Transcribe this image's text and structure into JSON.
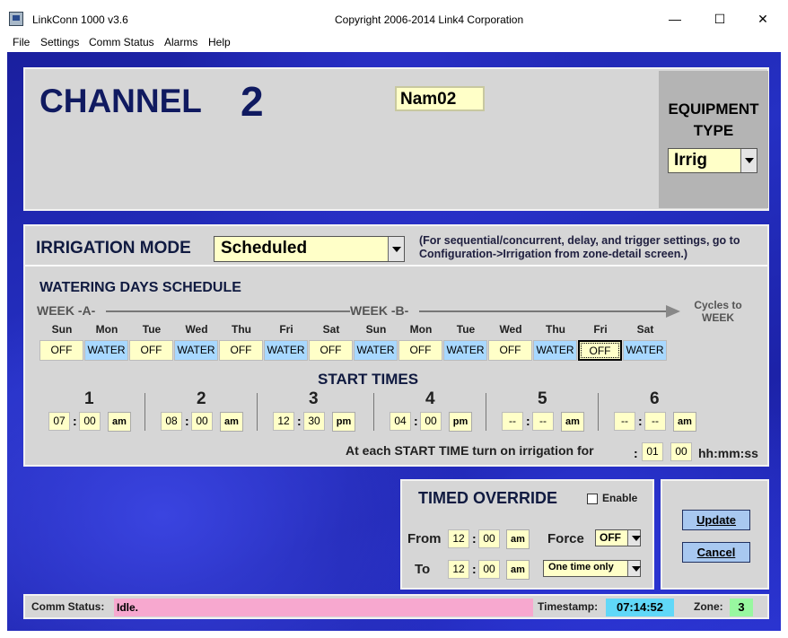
{
  "window": {
    "title": "LinkConn 1000 v3.6",
    "copyright": "Copyright 2006-2014 Link4 Corporation",
    "minimize": "—",
    "maximize": "☐",
    "close": "✕"
  },
  "menu": [
    "File",
    "Settings",
    "Comm Status",
    "Alarms",
    "Help"
  ],
  "channel": {
    "label": "CHANNEL",
    "number": "2",
    "name": "Nam02"
  },
  "equipment": {
    "label_line1": "EQUIPMENT",
    "label_line2": "TYPE",
    "value": "Irrig"
  },
  "irrigation": {
    "mode_label": "IRRIGATION MODE",
    "mode_value": "Scheduled",
    "note": "(For sequential/concurrent, delay, and trigger settings, go to Configuration->Irrigation from zone-detail screen.)"
  },
  "schedule": {
    "title": "WATERING DAYS SCHEDULE",
    "week_a": "WEEK -A-",
    "week_b": "WEEK -B-",
    "cycles": "Cycles to WEEK",
    "days": [
      {
        "name": "Sun",
        "state": "OFF"
      },
      {
        "name": "Mon",
        "state": "WATER"
      },
      {
        "name": "Tue",
        "state": "OFF"
      },
      {
        "name": "Wed",
        "state": "WATER"
      },
      {
        "name": "Thu",
        "state": "OFF"
      },
      {
        "name": "Fri",
        "state": "WATER"
      },
      {
        "name": "Sat",
        "state": "OFF"
      },
      {
        "name": "Sun",
        "state": "WATER"
      },
      {
        "name": "Mon",
        "state": "OFF"
      },
      {
        "name": "Tue",
        "state": "WATER"
      },
      {
        "name": "Wed",
        "state": "OFF"
      },
      {
        "name": "Thu",
        "state": "WATER"
      },
      {
        "name": "Fri",
        "state": "OFF"
      },
      {
        "name": "Sat",
        "state": "WATER"
      }
    ]
  },
  "start_times": {
    "title": "START TIMES",
    "entries": [
      {
        "num": "1",
        "hh": "07",
        "mm": "00",
        "ampm": "am"
      },
      {
        "num": "2",
        "hh": "08",
        "mm": "00",
        "ampm": "am"
      },
      {
        "num": "3",
        "hh": "12",
        "mm": "30",
        "ampm": "pm"
      },
      {
        "num": "4",
        "hh": "04",
        "mm": "00",
        "ampm": "pm"
      },
      {
        "num": "5",
        "hh": "--",
        "mm": "--",
        "ampm": "am"
      },
      {
        "num": "6",
        "hh": "--",
        "mm": "--",
        "ampm": "am"
      }
    ],
    "duration_label": "At each START TIME turn on irrigation for",
    "duration_h": "01",
    "duration_m": "00",
    "duration_unit": "hh:mm:ss"
  },
  "override": {
    "title": "TIMED OVERRIDE",
    "enable_label": "Enable",
    "from_label": "From",
    "from_hh": "12",
    "from_mm": "00",
    "from_ampm": "am",
    "to_label": "To",
    "to_hh": "12",
    "to_mm": "00",
    "to_ampm": "am",
    "force_label": "Force",
    "force_value": "OFF",
    "repeat_value": "One time only"
  },
  "buttons": {
    "update": "Update",
    "cancel": "Cancel"
  },
  "status": {
    "comm_label": "Comm Status:",
    "comm_value": "Idle.",
    "timestamp_label": "Timestamp:",
    "timestamp_value": "07:14:52",
    "zone_label": "Zone:",
    "zone_value": "3"
  }
}
